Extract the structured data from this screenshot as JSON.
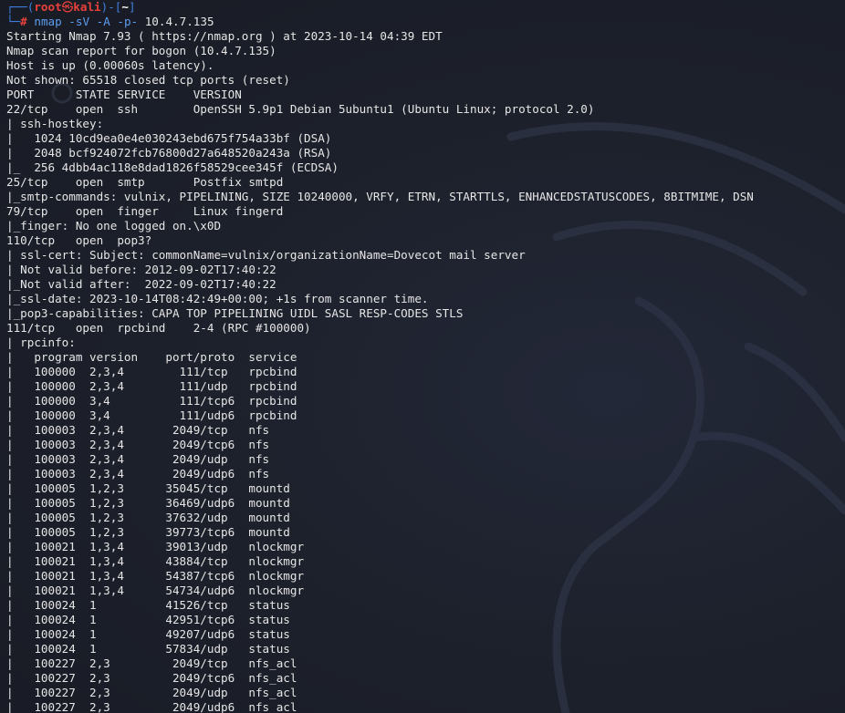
{
  "prompt": {
    "frame_top": "┌──(",
    "user": "root",
    "skull": "㉿",
    "host": "kali",
    "mid": ")-[",
    "dir": "~",
    "close": "]",
    "frame_bottom": "└─",
    "hash": "#",
    "command": "nmap",
    "options": "-sV -A -p-",
    "target": "10.4.7.135"
  },
  "output_lines": [
    "Starting Nmap 7.93 ( https://nmap.org ) at 2023-10-14 04:39 EDT",
    "Nmap scan report for bogon (10.4.7.135)",
    "Host is up (0.00060s latency).",
    "Not shown: 65518 closed tcp ports (reset)",
    "PORT      STATE SERVICE    VERSION",
    "22/tcp    open  ssh        OpenSSH 5.9p1 Debian 5ubuntu1 (Ubuntu Linux; protocol 2.0)",
    "| ssh-hostkey:",
    "|   1024 10cd9ea0e4e030243ebd675f754a33bf (DSA)",
    "|   2048 bcf924072fcb76800d27a648520a243a (RSA)",
    "|_  256 4dbb4ac118e8dad1826f58529cee345f (ECDSA)",
    "25/tcp    open  smtp       Postfix smtpd",
    "|_smtp-commands: vulnix, PIPELINING, SIZE 10240000, VRFY, ETRN, STARTTLS, ENHANCEDSTATUSCODES, 8BITMIME, DSN",
    "79/tcp    open  finger     Linux fingerd",
    "|_finger: No one logged on.\\x0D",
    "110/tcp   open  pop3?",
    "| ssl-cert: Subject: commonName=vulnix/organizationName=Dovecot mail server",
    "| Not valid before: 2012-09-02T17:40:22",
    "|_Not valid after:  2022-09-02T17:40:22",
    "|_ssl-date: 2023-10-14T08:42:49+00:00; +1s from scanner time.",
    "|_pop3-capabilities: CAPA TOP PIPELINING UIDL SASL RESP-CODES STLS",
    "111/tcp   open  rpcbind    2-4 (RPC #100000)",
    "| rpcinfo:",
    "|   program version    port/proto  service",
    "|   100000  2,3,4        111/tcp   rpcbind",
    "|   100000  2,3,4        111/udp   rpcbind",
    "|   100000  3,4          111/tcp6  rpcbind",
    "|   100000  3,4          111/udp6  rpcbind",
    "|   100003  2,3,4       2049/tcp   nfs",
    "|   100003  2,3,4       2049/tcp6  nfs",
    "|   100003  2,3,4       2049/udp   nfs",
    "|   100003  2,3,4       2049/udp6  nfs",
    "|   100005  1,2,3      35045/tcp   mountd",
    "|   100005  1,2,3      36469/udp6  mountd",
    "|   100005  1,2,3      37632/udp   mountd",
    "|   100005  1,2,3      39773/tcp6  mountd",
    "|   100021  1,3,4      39013/udp   nlockmgr",
    "|   100021  1,3,4      43884/tcp   nlockmgr",
    "|   100021  1,3,4      54387/tcp6  nlockmgr",
    "|   100021  1,3,4      54734/udp6  nlockmgr",
    "|   100024  1          41526/tcp   status",
    "|   100024  1          42951/tcp6  status",
    "|   100024  1          49207/udp6  status",
    "|   100024  1          57834/udp   status",
    "|   100227  2,3         2049/tcp   nfs_acl",
    "|   100227  2,3         2049/tcp6  nfs_acl",
    "|   100227  2,3         2049/udp   nfs_acl",
    "|_  100227  2,3         2049/udp6  nfs_acl"
  ],
  "colors": {
    "background": "#1b1e28",
    "text": "#e6e6e6",
    "prompt_frame": "#3f7fe0",
    "prompt_user": "#e8413c",
    "command": "#5d9ef0"
  }
}
